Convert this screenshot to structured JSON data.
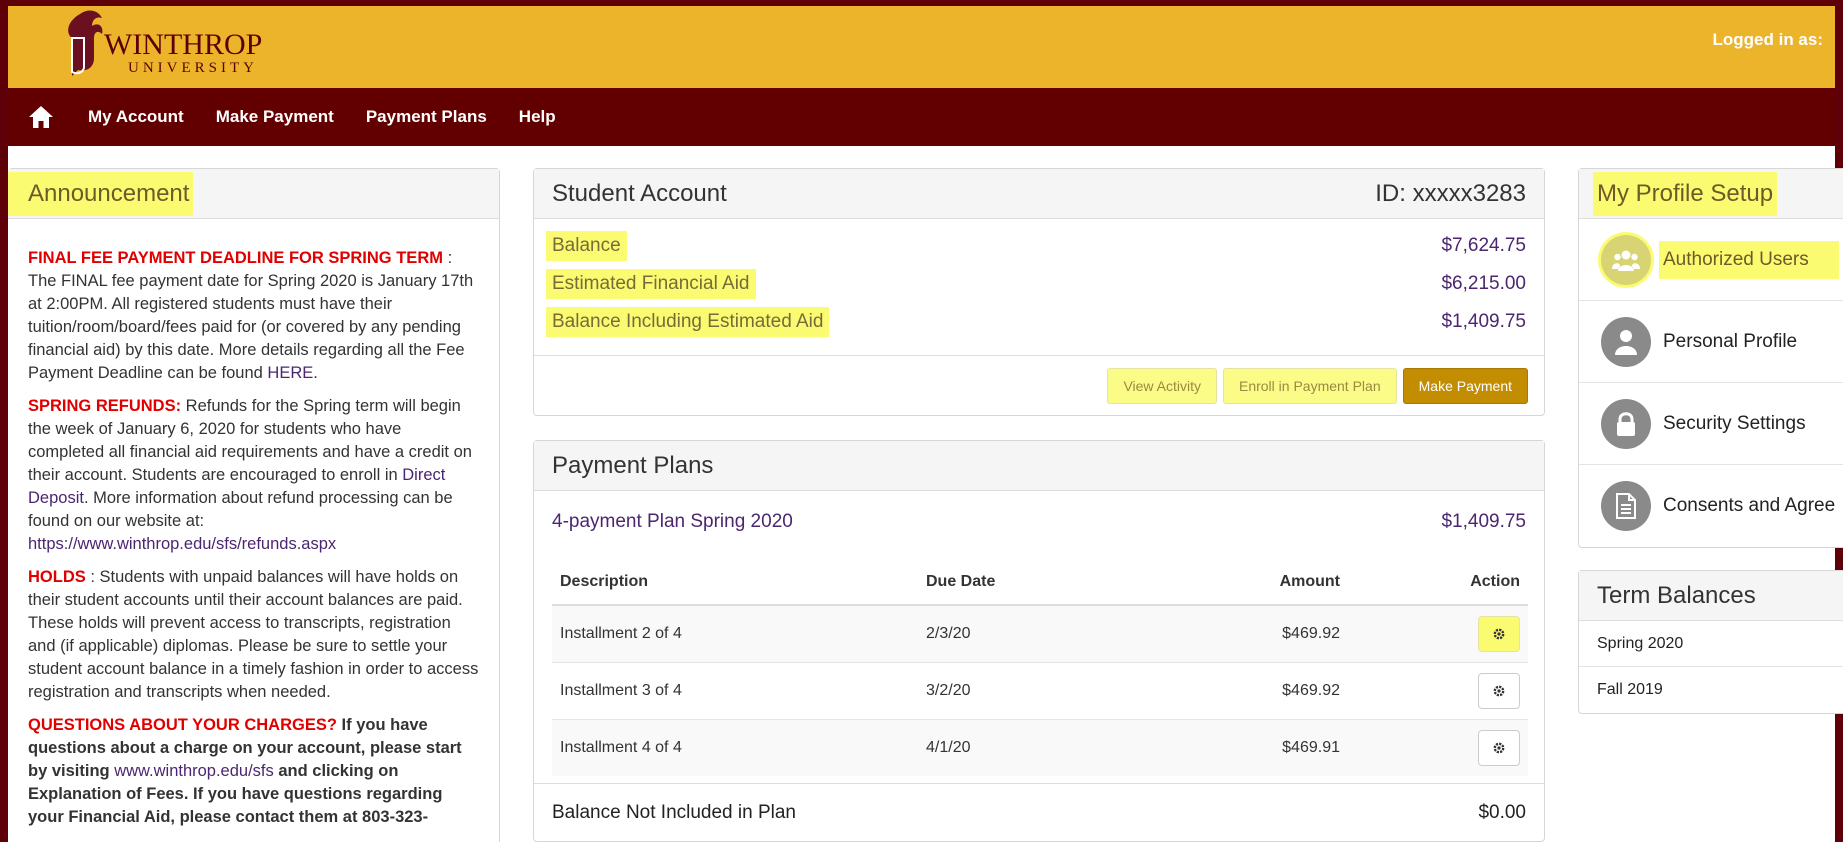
{
  "header": {
    "logo_name": "WINTHROP",
    "logo_sub": "UNIVERSITY",
    "logged_in": "Logged in as:"
  },
  "nav": {
    "items": [
      "My Account",
      "Make Payment",
      "Payment Plans",
      "Help"
    ]
  },
  "announcement": {
    "title": "Announcement",
    "p1_head": "FINAL FEE PAYMENT DEADLINE FOR SPRING TERM",
    "p1_sep": " : ",
    "p1_text": "The FINAL fee payment date for Spring 2020 is January 17th at 2:00PM. All registered students must have their tuition/room/board/fees paid for (or covered by any pending financial aid) by this date. More details regarding all the Fee Payment Deadline can be found ",
    "p1_link": "HERE",
    "p1_end": ".",
    "p2_head": "SPRING REFUNDS:",
    "p2_text": " Refunds for the Spring term will begin the week of January 6, 2020 for students who have completed all financial aid requirements and have a credit on their account. Students are encouraged to enroll in ",
    "p2_link": "Direct Deposit",
    "p2_text2": ". More information about refund processing can be found on our website at: ",
    "p2_url": "https://www.winthrop.edu/sfs/refunds.aspx",
    "p3_head": "HOLDS",
    "p3_text": " : Students with unpaid balances will have holds on their student accounts until their account balances are paid. These holds will prevent access to transcripts, registration and (if applicable) diplomas. Please be sure to settle your student account balance in a timely fashion in order to access registration and transcripts when needed.",
    "p4_head": "QUESTIONS ABOUT YOUR CHARGES?",
    "p4_text": " If you have questions about a charge on your account, please start by visiting ",
    "p4_link": "www.winthrop.edu/sfs",
    "p4_text2": " and clicking on Explanation of Fees. If you have questions regarding your Financial Aid, please contact them at 803-323-"
  },
  "account": {
    "title": "Student Account",
    "id": "ID: xxxxx3283",
    "rows": [
      {
        "label": "Balance",
        "value": "$7,624.75"
      },
      {
        "label": "Estimated Financial Aid",
        "value": "$6,215.00"
      },
      {
        "label": "Balance Including Estimated Aid",
        "value": "$1,409.75"
      }
    ],
    "buttons": {
      "view_activity": "View Activity",
      "enroll": "Enroll in Payment Plan",
      "make_payment": "Make Payment"
    }
  },
  "plans": {
    "title": "Payment Plans",
    "plan_name": "4-payment Plan Spring 2020",
    "plan_amount": "$1,409.75",
    "columns": [
      "Description",
      "Due Date",
      "Amount",
      "Action"
    ],
    "rows": [
      {
        "description": "Installment 2 of 4",
        "due": "2/3/20",
        "amount": "$469.92"
      },
      {
        "description": "Installment 3 of 4",
        "due": "3/2/20",
        "amount": "$469.92"
      },
      {
        "description": "Installment 4 of 4",
        "due": "4/1/20",
        "amount": "$469.91"
      }
    ],
    "footer_label": "Balance Not Included in Plan",
    "footer_value": "$0.00"
  },
  "profile": {
    "title": "My Profile Setup",
    "items": [
      "Authorized Users",
      "Personal Profile",
      "Security Settings",
      "Consents and Agree"
    ]
  },
  "terms": {
    "title": "Term Balances",
    "items": [
      "Spring 2020",
      "Fall 2019"
    ]
  },
  "colors": {
    "gold": "#ebb42a",
    "maroon": "#620001",
    "purple": "#4b2670",
    "highlight": "#fbfb72"
  }
}
